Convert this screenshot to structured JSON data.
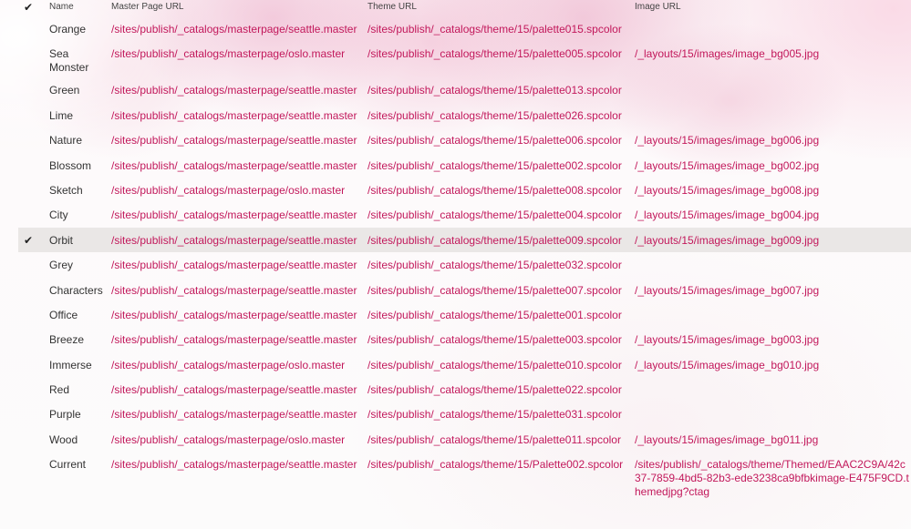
{
  "columns": {
    "select_all_icon": "checkmark-icon",
    "name": "Name",
    "master": "Master Page URL",
    "theme": "Theme URL",
    "image": "Image URL"
  },
  "rows": [
    {
      "name": "Orange",
      "master": "/sites/publish/_catalogs/masterpage/seattle.master",
      "theme": "/sites/publish/_catalogs/theme/15/palette015.spcolor",
      "image": "",
      "selected": false
    },
    {
      "name": "Sea Monster",
      "master": "/sites/publish/_catalogs/masterpage/oslo.master",
      "theme": "/sites/publish/_catalogs/theme/15/palette005.spcolor",
      "image": "/_layouts/15/images/image_bg005.jpg",
      "selected": false
    },
    {
      "name": "Green",
      "master": "/sites/publish/_catalogs/masterpage/seattle.master",
      "theme": "/sites/publish/_catalogs/theme/15/palette013.spcolor",
      "image": "",
      "selected": false
    },
    {
      "name": "Lime",
      "master": "/sites/publish/_catalogs/masterpage/seattle.master",
      "theme": "/sites/publish/_catalogs/theme/15/palette026.spcolor",
      "image": "",
      "selected": false
    },
    {
      "name": "Nature",
      "master": "/sites/publish/_catalogs/masterpage/seattle.master",
      "theme": "/sites/publish/_catalogs/theme/15/palette006.spcolor",
      "image": "/_layouts/15/images/image_bg006.jpg",
      "selected": false
    },
    {
      "name": "Blossom",
      "master": "/sites/publish/_catalogs/masterpage/seattle.master",
      "theme": "/sites/publish/_catalogs/theme/15/palette002.spcolor",
      "image": "/_layouts/15/images/image_bg002.jpg",
      "selected": false
    },
    {
      "name": "Sketch",
      "master": "/sites/publish/_catalogs/masterpage/oslo.master",
      "theme": "/sites/publish/_catalogs/theme/15/palette008.spcolor",
      "image": "/_layouts/15/images/image_bg008.jpg",
      "selected": false
    },
    {
      "name": "City",
      "master": "/sites/publish/_catalogs/masterpage/seattle.master",
      "theme": "/sites/publish/_catalogs/theme/15/palette004.spcolor",
      "image": "/_layouts/15/images/image_bg004.jpg",
      "selected": false
    },
    {
      "name": "Orbit",
      "master": "/sites/publish/_catalogs/masterpage/seattle.master",
      "theme": "/sites/publish/_catalogs/theme/15/palette009.spcolor",
      "image": "/_layouts/15/images/image_bg009.jpg",
      "selected": true
    },
    {
      "name": "Grey",
      "master": "/sites/publish/_catalogs/masterpage/seattle.master",
      "theme": "/sites/publish/_catalogs/theme/15/palette032.spcolor",
      "image": "",
      "selected": false
    },
    {
      "name": "Characters",
      "master": "/sites/publish/_catalogs/masterpage/seattle.master",
      "theme": "/sites/publish/_catalogs/theme/15/palette007.spcolor",
      "image": "/_layouts/15/images/image_bg007.jpg",
      "selected": false
    },
    {
      "name": "Office",
      "master": "/sites/publish/_catalogs/masterpage/seattle.master",
      "theme": "/sites/publish/_catalogs/theme/15/palette001.spcolor",
      "image": "",
      "selected": false
    },
    {
      "name": "Breeze",
      "master": "/sites/publish/_catalogs/masterpage/seattle.master",
      "theme": "/sites/publish/_catalogs/theme/15/palette003.spcolor",
      "image": "/_layouts/15/images/image_bg003.jpg",
      "selected": false
    },
    {
      "name": "Immerse",
      "master": "/sites/publish/_catalogs/masterpage/oslo.master",
      "theme": "/sites/publish/_catalogs/theme/15/palette010.spcolor",
      "image": "/_layouts/15/images/image_bg010.jpg",
      "selected": false
    },
    {
      "name": "Red",
      "master": "/sites/publish/_catalogs/masterpage/seattle.master",
      "theme": "/sites/publish/_catalogs/theme/15/palette022.spcolor",
      "image": "",
      "selected": false
    },
    {
      "name": "Purple",
      "master": "/sites/publish/_catalogs/masterpage/seattle.master",
      "theme": "/sites/publish/_catalogs/theme/15/palette031.spcolor",
      "image": "",
      "selected": false
    },
    {
      "name": "Wood",
      "master": "/sites/publish/_catalogs/masterpage/oslo.master",
      "theme": "/sites/publish/_catalogs/theme/15/palette011.spcolor",
      "image": "/_layouts/15/images/image_bg011.jpg",
      "selected": false
    },
    {
      "name": "Current",
      "master": "/sites/publish/_catalogs/masterpage/seattle.master",
      "theme": "/sites/publish/_catalogs/theme/15/Palette002.spcolor",
      "image": "/sites/publish/_catalogs/theme/Themed/EAAC2C9A/42c37-7859-4bd5-82b3-ede3238ca9bfbkimage-E475F9CD.themedjpg?ctag",
      "selected": false
    }
  ],
  "colors": {
    "link": "#c2185b",
    "text": "#333333",
    "selected_row": "#e8e5e4"
  }
}
